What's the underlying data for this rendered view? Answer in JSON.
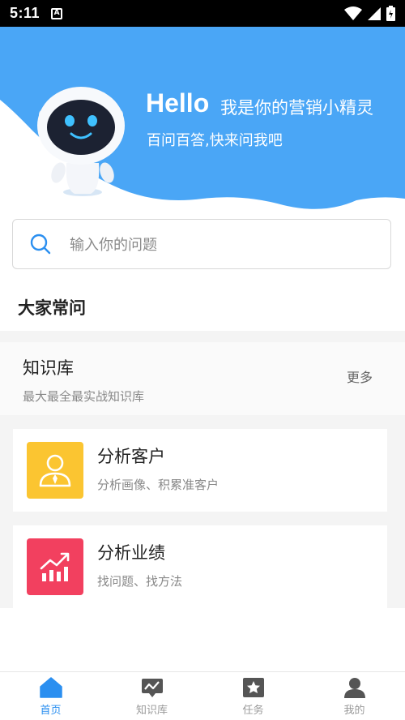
{
  "status_bar": {
    "time": "5:11",
    "app_icon_letter": "A"
  },
  "hero": {
    "hello": "Hello",
    "hello_sub": "我是你的营销小精灵",
    "tagline": "百问百答,快来问我吧",
    "bg_color": "#4aa6f6"
  },
  "search": {
    "placeholder": "输入你的问题"
  },
  "faq": {
    "title": "大家常问"
  },
  "knowledge": {
    "title": "知识库",
    "subtitle": "最大最全最实战知识库",
    "more": "更多",
    "items": [
      {
        "title": "分析客户",
        "subtitle": "分析画像、积累准客户",
        "icon": "customer-icon",
        "color": "#fbc531"
      },
      {
        "title": "分析业绩",
        "subtitle": "找问题、找方法",
        "icon": "chart-up-icon",
        "color": "#f2405f"
      }
    ]
  },
  "tabbar": {
    "active_color": "#2b8ff0",
    "tabs": [
      {
        "label": "首页",
        "icon": "home-icon",
        "active": true
      },
      {
        "label": "知识库",
        "icon": "knowledge-icon",
        "active": false
      },
      {
        "label": "任务",
        "icon": "task-star-icon",
        "active": false
      },
      {
        "label": "我的",
        "icon": "profile-icon",
        "active": false
      }
    ]
  }
}
